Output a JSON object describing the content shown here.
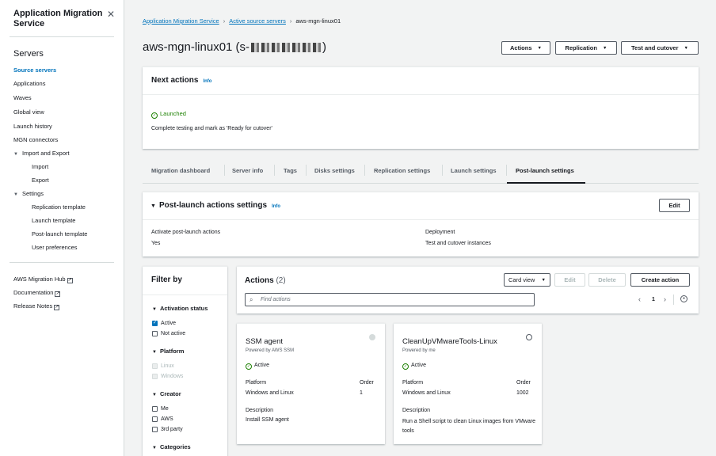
{
  "sidebar": {
    "title": "Application Migration Service",
    "section": "Servers",
    "items": [
      {
        "label": "Source servers",
        "active": true
      },
      {
        "label": "Applications"
      },
      {
        "label": "Waves"
      },
      {
        "label": "Global view"
      },
      {
        "label": "Launch history"
      },
      {
        "label": "MGN connectors"
      }
    ],
    "import_export": {
      "label": "Import and Export",
      "children": [
        "Import",
        "Export"
      ]
    },
    "settings": {
      "label": "Settings",
      "children": [
        "Replication template",
        "Launch template",
        "Post-launch template",
        "User preferences"
      ]
    },
    "links": [
      "AWS Migration Hub",
      "Documentation",
      "Release Notes"
    ]
  },
  "breadcrumb": [
    "Application Migration Service",
    "Active source servers",
    "aws-mgn-linux01"
  ],
  "page_title": "aws-mgn-linux01 (s-",
  "page_title_end": ")",
  "header_buttons": {
    "actions": "Actions",
    "replication": "Replication",
    "test_cutover": "Test and cutover"
  },
  "next_actions": {
    "title": "Next actions",
    "info": "Info",
    "status": "Launched",
    "message": "Complete testing and mark as 'Ready for cutover'"
  },
  "tabs": [
    "Migration dashboard",
    "Server info",
    "Tags",
    "Disks settings",
    "Replication settings",
    "Launch settings",
    "Post-launch settings"
  ],
  "post_launch": {
    "title": "Post-launch actions settings",
    "info": "Info",
    "edit": "Edit",
    "activate_label": "Activate post-launch actions",
    "activate_value": "Yes",
    "deployment_label": "Deployment",
    "deployment_value": "Test and cutover instances"
  },
  "filter": {
    "title": "Filter by",
    "activation_status": {
      "label": "Activation status",
      "options": [
        {
          "label": "Active",
          "checked": true
        },
        {
          "label": "Not active",
          "checked": false
        }
      ]
    },
    "platform": {
      "label": "Platform",
      "options": [
        {
          "label": "Linux"
        },
        {
          "label": "Windows"
        }
      ]
    },
    "creator": {
      "label": "Creator",
      "options": [
        {
          "label": "Me"
        },
        {
          "label": "AWS"
        },
        {
          "label": "3rd party"
        }
      ]
    },
    "categories": {
      "label": "Categories"
    }
  },
  "actions_panel": {
    "title": "Actions",
    "count": "(2)",
    "view_select": "Card view",
    "edit": "Edit",
    "delete": "Delete",
    "create": "Create action",
    "search_placeholder": "Find actions",
    "page": "1"
  },
  "cards": [
    {
      "title": "SSM agent",
      "powered": "Powered by AWS SSM",
      "status": "Active",
      "platform_label": "Platform",
      "platform": "Windows and Linux",
      "order_label": "Order",
      "order": "1",
      "desc_label": "Description",
      "desc": "Install SSM agent"
    },
    {
      "title": "CleanUpVMwareTools-Linux",
      "powered": "Powered by me",
      "status": "Active",
      "platform_label": "Platform",
      "platform": "Windows and Linux",
      "order_label": "Order",
      "order": "1002",
      "desc_label": "Description",
      "desc": "Run a Shell script to clean Linux images from VMware tools"
    }
  ],
  "colors": {
    "link": "#0073bb",
    "success": "#1d8102",
    "border": "#545b64",
    "background": "#f2f3f3"
  }
}
